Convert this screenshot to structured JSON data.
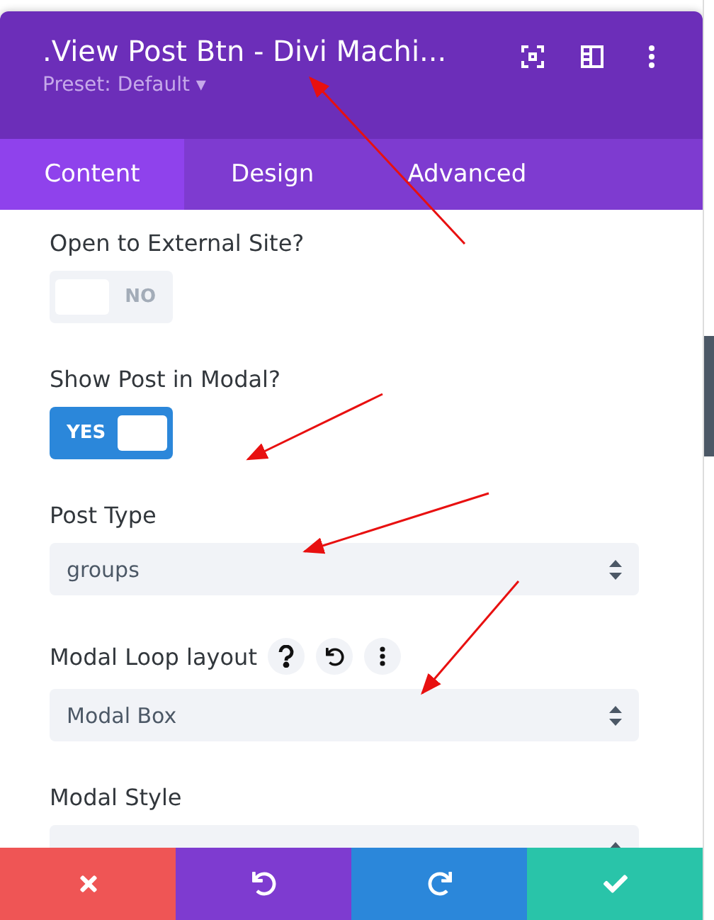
{
  "panel": {
    "title": ".View Post Btn - Divi Machi...",
    "preset": "Preset: Default ▾"
  },
  "tabs": [
    {
      "label": "Content",
      "selected": true
    },
    {
      "label": "Design",
      "selected": false
    },
    {
      "label": "Advanced",
      "selected": false
    }
  ],
  "fields": [
    {
      "kind": "toggle",
      "label": "Open to External Site?",
      "on": false,
      "text": "NO"
    },
    {
      "kind": "toggle",
      "label": "Show Post in Modal?",
      "on": true,
      "text": "YES"
    },
    {
      "kind": "select",
      "label": "Post Type",
      "value": "groups"
    },
    {
      "kind": "select",
      "label": "Modal Loop layout",
      "value": "Modal Box",
      "tools": [
        {
          "kind": "help"
        },
        {
          "kind": "reset"
        },
        {
          "kind": "more"
        }
      ]
    },
    {
      "kind": "select",
      "label": "Modal Style"
    }
  ],
  "footer": [
    {
      "kind": "cancel"
    },
    {
      "kind": "undo"
    },
    {
      "kind": "redo"
    },
    {
      "kind": "save"
    }
  ]
}
